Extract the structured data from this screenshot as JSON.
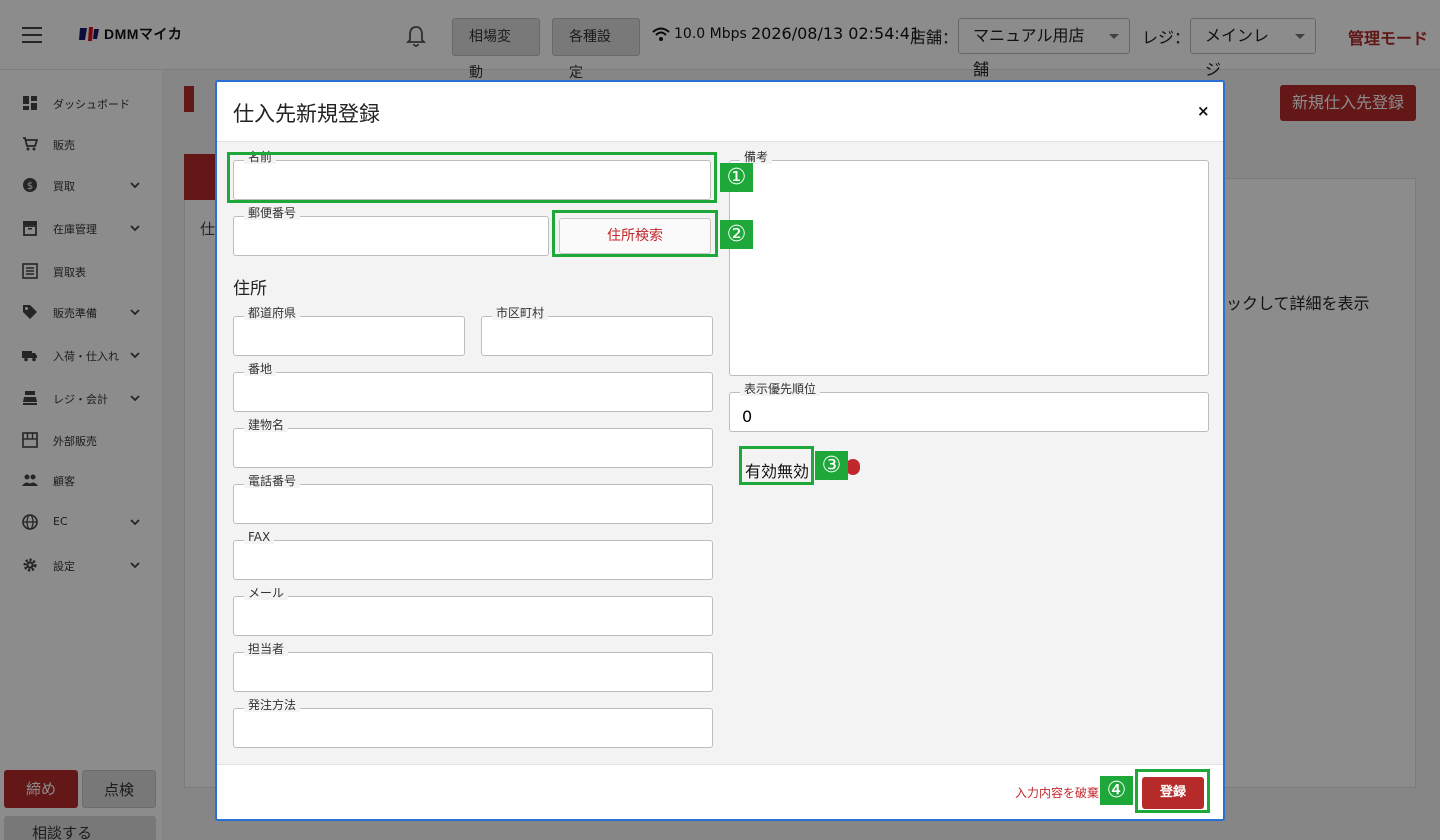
{
  "header": {
    "logo_text": "DMMマイカ",
    "market_button": "相場変動",
    "settings_button": "各種設定",
    "network_speed": "10.0 Mbps",
    "datetime": "2026/08/13 02:54:41",
    "store_label": "店舗：",
    "store_value": "マニュアル用店舗",
    "register_label": "レジ：",
    "register_value": "メインレジ",
    "admin_mode": "管理モード"
  },
  "sidebar": {
    "items": [
      {
        "label": "ダッシュボード",
        "icon": "dashboard-icon",
        "expandable": false
      },
      {
        "label": "販売",
        "icon": "cart-icon",
        "expandable": false
      },
      {
        "label": "買取",
        "icon": "dollar-icon",
        "expandable": true
      },
      {
        "label": "在庫管理",
        "icon": "archive-icon",
        "expandable": true
      },
      {
        "label": "買取表",
        "icon": "list-icon",
        "expandable": false
      },
      {
        "label": "販売準備",
        "icon": "tag-icon",
        "expandable": true
      },
      {
        "label": "入荷・仕入れ",
        "icon": "truck-icon",
        "expandable": true
      },
      {
        "label": "レジ・会計",
        "icon": "register-icon",
        "expandable": true
      },
      {
        "label": "外部販売",
        "icon": "store-icon",
        "expandable": false
      },
      {
        "label": "顧客",
        "icon": "people-icon",
        "expandable": false
      },
      {
        "label": "EC",
        "icon": "globe-icon",
        "expandable": true
      },
      {
        "label": "設定",
        "icon": "gear-icon",
        "expandable": true
      }
    ],
    "close_day_button": "締め",
    "check_button": "点検",
    "consult_button": "相談する"
  },
  "background": {
    "new_supplier_button": "新規仕入先登録",
    "column_fragment": "仕",
    "hint_fragment": "ックして詳細を表示"
  },
  "modal": {
    "title": "仕入先新規登録",
    "close": "×",
    "fields": {
      "name": {
        "label": "名前",
        "value": ""
      },
      "postal": {
        "label": "郵便番号",
        "value": ""
      },
      "prefecture": {
        "label": "都道府県",
        "value": ""
      },
      "city": {
        "label": "市区町村",
        "value": ""
      },
      "street": {
        "label": "番地",
        "value": ""
      },
      "building": {
        "label": "建物名",
        "value": ""
      },
      "phone": {
        "label": "電話番号",
        "value": ""
      },
      "fax": {
        "label": "FAX",
        "value": ""
      },
      "email": {
        "label": "メール",
        "value": ""
      },
      "contact": {
        "label": "担当者",
        "value": ""
      },
      "order_method": {
        "label": "発注方法",
        "value": ""
      },
      "notes": {
        "label": "備考",
        "value": ""
      },
      "priority": {
        "label": "表示優先順位",
        "value": "0"
      }
    },
    "address_section": "住所",
    "address_search_button": "住所検索",
    "toggle_label": "有効無効",
    "discard_link": "入力内容を破棄",
    "register_button": "登録"
  },
  "annotations": [
    "①",
    "②",
    "③",
    "④"
  ],
  "colors": {
    "accent": "#b72a2a",
    "annotation": "#1ea83a",
    "modal_border": "#2a6fd6"
  }
}
